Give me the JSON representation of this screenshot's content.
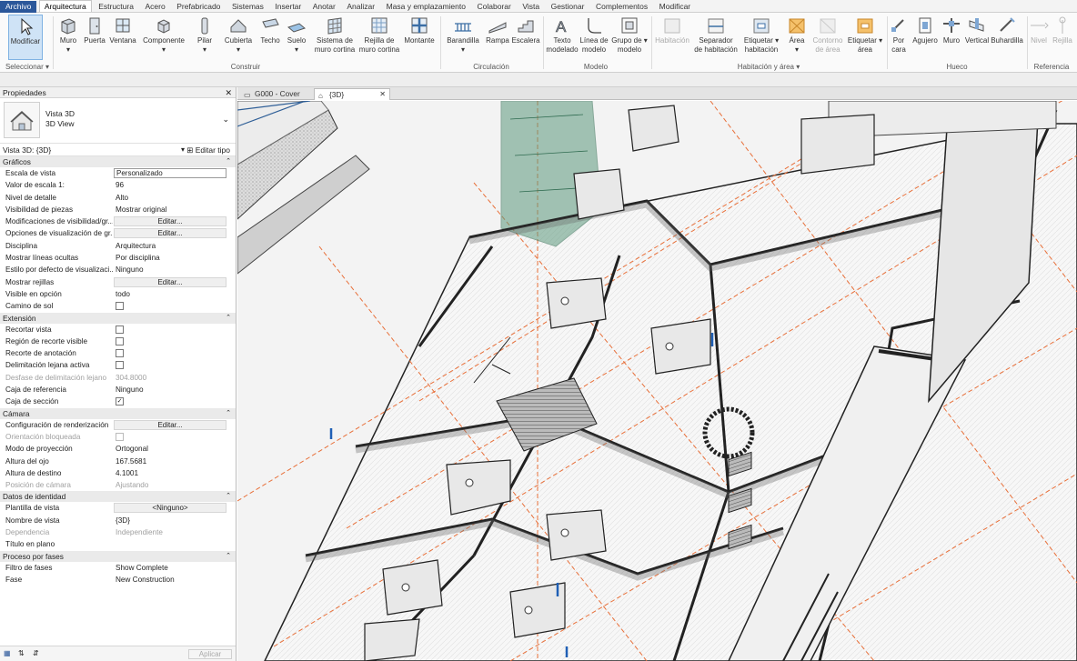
{
  "menu": {
    "tabs": [
      "Archivo",
      "Arquitectura",
      "Estructura",
      "Acero",
      "Prefabricado",
      "Sistemas",
      "Insertar",
      "Anotar",
      "Analizar",
      "Masa y emplazamiento",
      "Colaborar",
      "Vista",
      "Gestionar",
      "Complementos",
      "Modificar"
    ],
    "active_index": 1
  },
  "ribbon": {
    "modify": "Modificar",
    "select_panel": "Seleccionar",
    "build_panel": "Construir",
    "circulation_panel": "Circulación",
    "model_panel": "Modelo",
    "room_panel": "Habitación y área",
    "opening_panel": "Hueco",
    "datum_panel": "Referencia",
    "buttons": {
      "wall": "Muro",
      "door": "Puerta",
      "window": "Ventana",
      "component": "Componente",
      "column": "Pilar",
      "roof": "Cubierta",
      "ceiling": "Techo",
      "floor": "Suelo",
      "curtain_system_1": "Sistema de",
      "curtain_system_2": "muro cortina",
      "curtain_grid_1": "Rejilla de",
      "curtain_grid_2": "muro cortina",
      "mullion": "Montante",
      "railing": "Barandilla",
      "ramp": "Rampa",
      "stair": "Escalera",
      "model_text_1": "Texto",
      "model_text_2": "modelado",
      "model_line_1": "Línea de",
      "model_line_2": "modelo",
      "model_group_1": "Grupo de",
      "model_group_2": "modelo",
      "room": "Habitación",
      "room_sep_1": "Separador",
      "room_sep_2": "de habitación",
      "tag_room_1": "Etiquetar",
      "tag_room_2": "habitación",
      "area": "Área",
      "area_boundary_1": "Contorno",
      "area_boundary_2": "de área",
      "tag_area_1": "Etiquetar",
      "tag_area_2": "área",
      "by_face_1": "Por",
      "by_face_2": "cara",
      "shaft": "Agujero",
      "wall_open": "Muro",
      "vertical": "Vertical",
      "dormer": "Buhardilla",
      "level": "Nivel",
      "grid": "Rejilla"
    }
  },
  "properties": {
    "title": "Propiedades",
    "close": "✕",
    "type_name_1": "Vista 3D",
    "type_name_2": "3D View",
    "view_selector": "Vista 3D: {3D}",
    "edit_type": "Editar tipo",
    "sections": [
      {
        "name": "Gráficos",
        "rows": [
          {
            "k": "Escala de vista",
            "v": "Personalizado",
            "t": "input"
          },
          {
            "k": "Valor de escala    1:",
            "v": "96",
            "t": "text"
          },
          {
            "k": "Nivel de detalle",
            "v": "Alto",
            "t": "text"
          },
          {
            "k": "Visibilidad de piezas",
            "v": "Mostrar original",
            "t": "text"
          },
          {
            "k": "Modificaciones de visibilidad/gr...",
            "v": "Editar...",
            "t": "button"
          },
          {
            "k": "Opciones de visualización de gr...",
            "v": "Editar...",
            "t": "button"
          },
          {
            "k": "Disciplina",
            "v": "Arquitectura",
            "t": "text"
          },
          {
            "k": "Mostrar líneas ocultas",
            "v": "Por disciplina",
            "t": "text"
          },
          {
            "k": "Estilo por defecto de visualizaci...",
            "v": "Ninguno",
            "t": "text"
          },
          {
            "k": "Mostrar rejillas",
            "v": "Editar...",
            "t": "button"
          },
          {
            "k": "Visible en opción",
            "v": "todo",
            "t": "text"
          },
          {
            "k": "Camino de sol",
            "v": "",
            "t": "check"
          }
        ]
      },
      {
        "name": "Extensión",
        "rows": [
          {
            "k": "Recortar vista",
            "v": "",
            "t": "check"
          },
          {
            "k": "Región de recorte visible",
            "v": "",
            "t": "check"
          },
          {
            "k": "Recorte de anotación",
            "v": "",
            "t": "check"
          },
          {
            "k": "Delimitación lejana activa",
            "v": "",
            "t": "check"
          },
          {
            "k": "Desfase de delimitación lejano",
            "v": "304.8000",
            "t": "grey"
          },
          {
            "k": "Caja de referencia",
            "v": "Ninguno",
            "t": "text"
          },
          {
            "k": "Caja de sección",
            "v": "✓",
            "t": "checked"
          }
        ]
      },
      {
        "name": "Cámara",
        "rows": [
          {
            "k": "Configuración de renderización",
            "v": "Editar...",
            "t": "button"
          },
          {
            "k": "Orientación bloqueada",
            "v": "",
            "t": "greycheck"
          },
          {
            "k": "Modo de proyección",
            "v": "Ortogonal",
            "t": "text"
          },
          {
            "k": "Altura del ojo",
            "v": "167.5681",
            "t": "text"
          },
          {
            "k": "Altura de destino",
            "v": "4.1001",
            "t": "text"
          },
          {
            "k": "Posición de cámara",
            "v": "Ajustando",
            "t": "grey"
          }
        ]
      },
      {
        "name": "Datos de identidad",
        "rows": [
          {
            "k": "Plantilla de vista",
            "v": "<Ninguno>",
            "t": "button"
          },
          {
            "k": "Nombre de vista",
            "v": "{3D}",
            "t": "text"
          },
          {
            "k": "Dependencia",
            "v": "Independiente",
            "t": "grey"
          },
          {
            "k": "Título en plano",
            "v": "",
            "t": "text"
          }
        ]
      },
      {
        "name": "Proceso por fases",
        "rows": [
          {
            "k": "Filtro de fases",
            "v": "Show Complete",
            "t": "text"
          },
          {
            "k": "Fase",
            "v": "New Construction",
            "t": "text"
          }
        ]
      }
    ],
    "apply": "Aplicar"
  },
  "doc_tabs": [
    {
      "label": "G000 - Cover",
      "active": false
    },
    {
      "label": "{3D}",
      "active": true
    }
  ],
  "colors": {
    "accent": "#2b579a",
    "section_line": "#e8703a",
    "glass": "#5e9a7e"
  }
}
